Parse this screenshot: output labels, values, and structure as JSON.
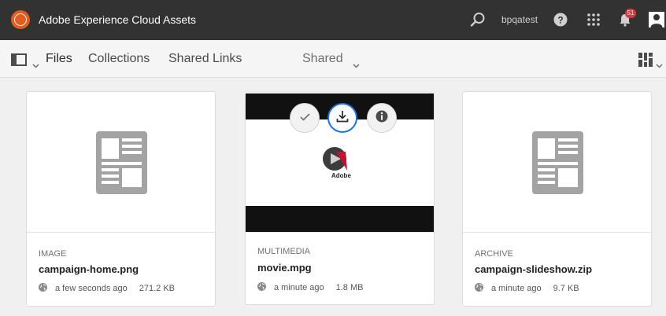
{
  "header": {
    "app_title": "Adobe Experience Cloud Assets",
    "username": "bpqatest",
    "notification_count": "51",
    "icons": [
      "search-icon",
      "help-icon",
      "apps-grid-icon",
      "bell-icon",
      "user-icon"
    ]
  },
  "nav": {
    "files": "Files",
    "collections": "Collections",
    "shared_links": "Shared Links",
    "filter": "Shared"
  },
  "cards": [
    {
      "type": "IMAGE",
      "name": "campaign-home.png",
      "time": "a few seconds ago",
      "size": "271.2 KB"
    },
    {
      "type": "MULTIMEDIA",
      "name": "movie.mpg",
      "time": "a minute ago",
      "size": "1.8 MB",
      "thumb_label": "Adobe",
      "actions": [
        "select-icon",
        "download-icon",
        "info-icon"
      ]
    },
    {
      "type": "ARCHIVE",
      "name": "campaign-slideshow.zip",
      "time": "a minute ago",
      "size": "9.7 KB"
    }
  ],
  "colors": {
    "topbar": "#323232",
    "accent_orange": "#e35b1d",
    "badge_red": "#d7373f",
    "focus_blue": "#1473e6"
  }
}
